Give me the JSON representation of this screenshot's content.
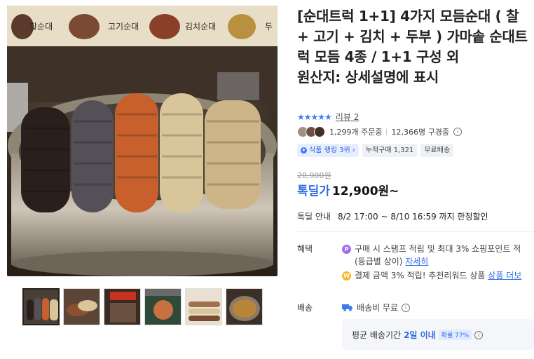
{
  "product": {
    "title": "[순대트럭 1+1] 4가지 모듬순대 ( 찰 + 고기 + 김치 + 두부 ) 가마솥 순대트럭 모듬 4종 / 1+1 구성 외",
    "origin": "원산지: 상세설명에 표시",
    "image_signs": [
      "찰순대",
      "고기순대",
      "김치순대",
      "두"
    ]
  },
  "rating": {
    "stars": "★★★★★",
    "review_label": "리뷰 2"
  },
  "stats": {
    "orders": "1,299개 주문중",
    "subscribers": "12,366명 구경중"
  },
  "badges": {
    "rank": "식품 랭킹 3위",
    "cumulative": "누적구매 1,321",
    "shipping": "무료배송"
  },
  "price": {
    "original": "20,900원",
    "deal_label": "톡딜가",
    "current": "12,900원~"
  },
  "deal": {
    "label": "톡딜 안내",
    "period": "8/2 17:00 ~ 8/10 16:59 까지 한정할인"
  },
  "benefit": {
    "label": "혜택",
    "line1": "구매 시 스탬프 적립 및 최대 3% 쇼핑포인트 적",
    "line2_text": "(등급별 상이)",
    "line2_link": "자세히",
    "line3_text": "결제 금액 3% 적립! 추천리워드 상품",
    "line3_link": "상품 더보"
  },
  "shipping": {
    "label": "배송",
    "fee": "배송비 무료",
    "delivery_prefix": "평균 배송기간",
    "delivery_highlight": "2일 이내",
    "delivery_pct": "확률 77%"
  },
  "colors": {
    "accent": "#2F6CE5",
    "star": "#3B7CF6",
    "point": "#a66cf0",
    "coin": "#f5b820"
  }
}
